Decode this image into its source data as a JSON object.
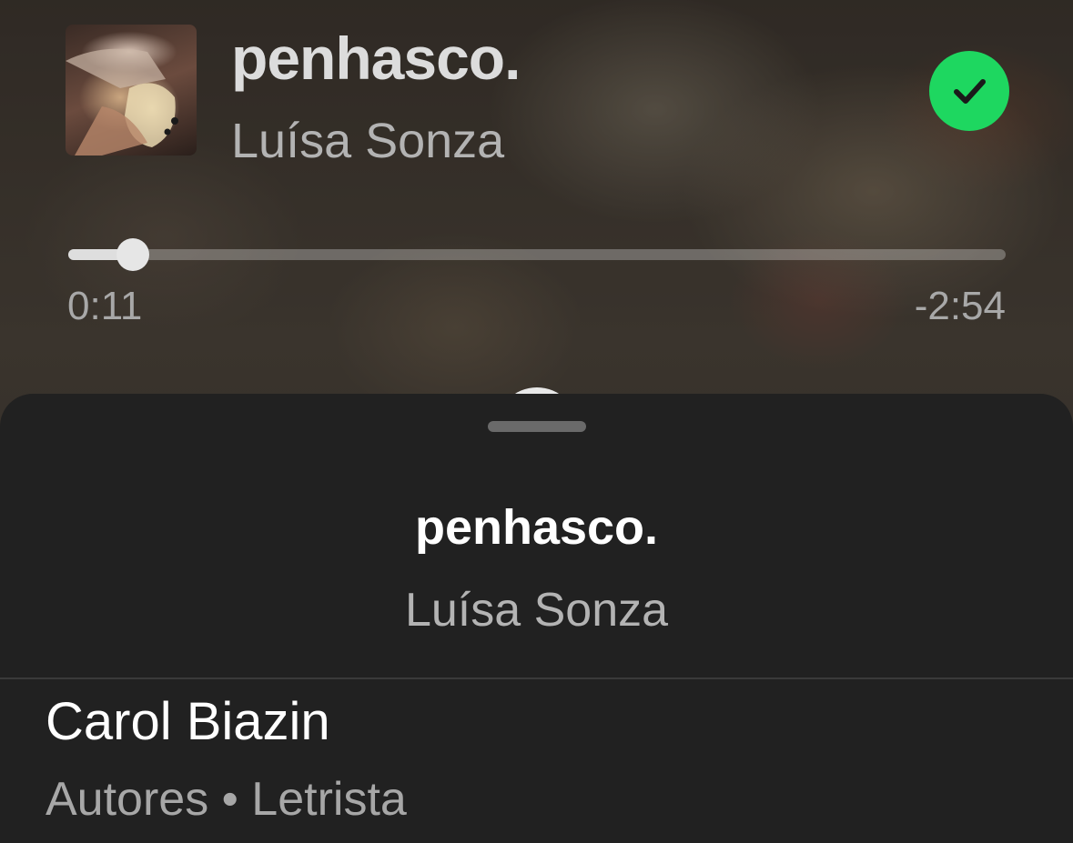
{
  "now_playing": {
    "title": "penhasco.",
    "artist": "Luísa Sonza",
    "liked_icon": "check-circle-icon",
    "liked_color": "#1ed760",
    "progress": {
      "elapsed": "0:11",
      "remaining": "-2:54",
      "fraction": 0.069
    }
  },
  "credits_sheet": {
    "title": "penhasco.",
    "artist": "Luísa Sonza",
    "credits": [
      {
        "name": "Carol Biazin",
        "roles": "Autores • Letrista"
      }
    ]
  },
  "colors": {
    "sheet_background": "#212121",
    "accent_green": "#1ed760"
  }
}
